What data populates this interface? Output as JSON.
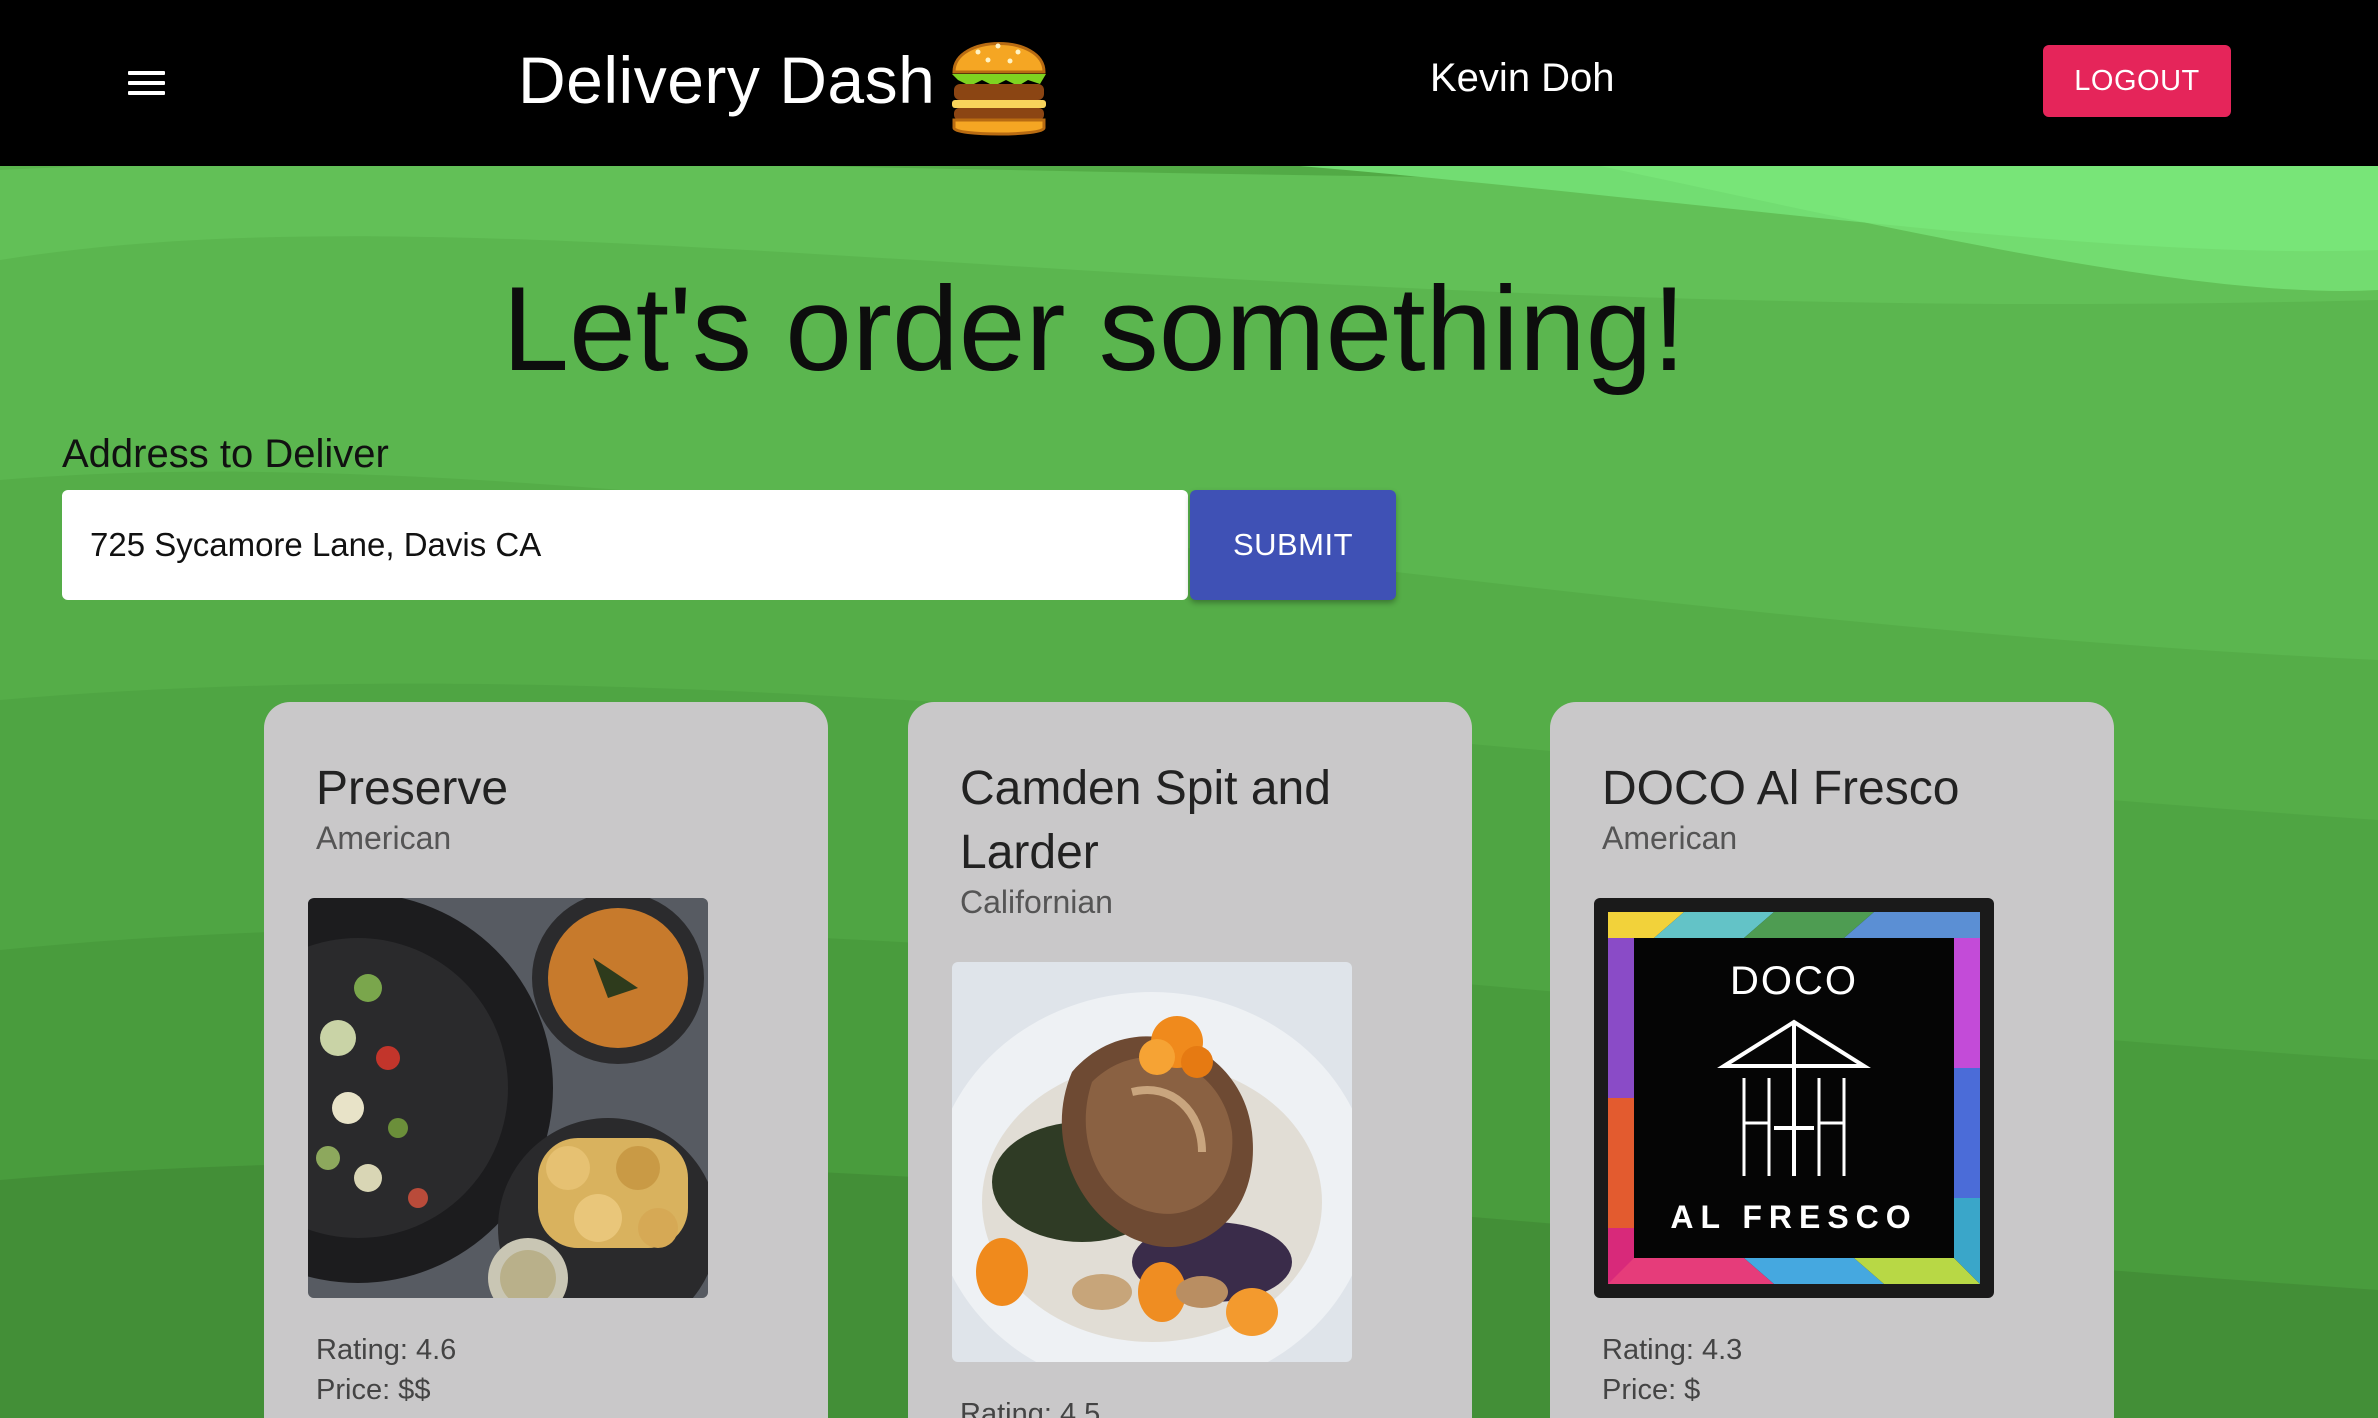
{
  "appbar": {
    "title": "Delivery Dash",
    "menu_icon": "hamburger-menu-icon",
    "logo_icon": "burger-icon",
    "user_name": "Kevin Doh",
    "logout_label": "LOGOUT"
  },
  "main": {
    "heading": "Let's order something!",
    "address_label": "Address to Deliver",
    "address_value": "725 Sycamore Lane, Davis CA",
    "submit_label": "SUBMIT"
  },
  "restaurants": [
    {
      "name": "Preserve",
      "cuisine": "American",
      "rating": "Rating: 4.6",
      "price": "Price: $$",
      "image": "food-photo-soup-salad-chips"
    },
    {
      "name": "Camden Spit and Larder",
      "cuisine": "Californian",
      "rating": "Rating: 4.5",
      "price": "",
      "image": "food-photo-grilled-pork-chop"
    },
    {
      "name": "DOCO Al Fresco",
      "cuisine": "American",
      "rating": "Rating: 4.3",
      "price": "Price: $",
      "image": "doco-al-fresco-logo",
      "logo_text_top": "DOCO",
      "logo_text_bottom": "AL FRESCO"
    }
  ],
  "colors": {
    "appbar": "#000000",
    "background_green": "#58b44a",
    "logout": "#e5255a",
    "submit": "#3f51b5",
    "card": "#c9c8c9"
  }
}
